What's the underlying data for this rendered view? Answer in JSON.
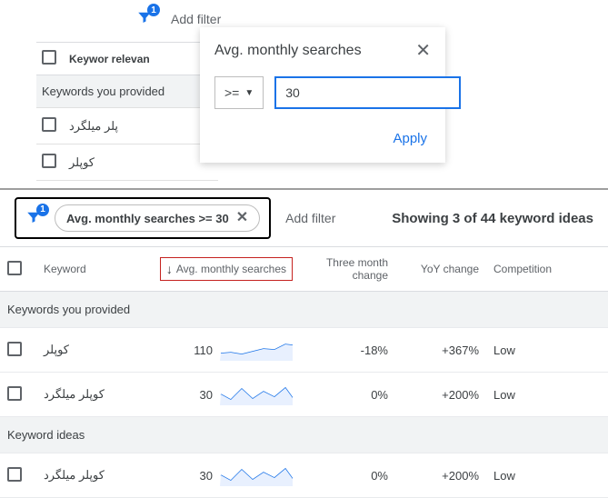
{
  "filter_badge": "1",
  "add_filter": "Add filter",
  "top_header": "Keywor relevan",
  "section_provided": "Keywords you provided",
  "section_ideas": "Keyword ideas",
  "top_rows": [
    {
      "kw": "پلر میلگرد"
    },
    {
      "kw": "کوپلر"
    }
  ],
  "popover": {
    "title": "Avg. monthly searches",
    "operator": ">=",
    "value": "30",
    "apply": "Apply"
  },
  "chip": "Avg. monthly searches >= 30",
  "showing": "Showing 3 of 44 keyword ideas",
  "columns": {
    "keyword": "Keyword",
    "avg": "Avg. monthly searches",
    "three_month": "Three month change",
    "yoy": "YoY change",
    "competition": "Competition"
  },
  "rows": [
    {
      "kw": "کوپلر",
      "avg": "110",
      "three_month": "-18%",
      "yoy": "+367%",
      "comp": "Low",
      "spark": "1,16 12,15 24,17 36,14 48,11 60,12 72,6 80,7"
    },
    {
      "kw": "کوپلر میلگرد",
      "avg": "30",
      "three_month": "0%",
      "yoy": "+200%",
      "comp": "Low",
      "spark": "1,12 12,18 24,6 36,17 48,9 60,15 72,5 80,16"
    }
  ],
  "idea_rows": [
    {
      "kw": "کوپلر میلگرد",
      "avg": "30",
      "three_month": "0%",
      "yoy": "+200%",
      "comp": "Low",
      "spark": "1,12 12,18 24,6 36,17 48,9 60,15 72,5 80,16"
    }
  ]
}
